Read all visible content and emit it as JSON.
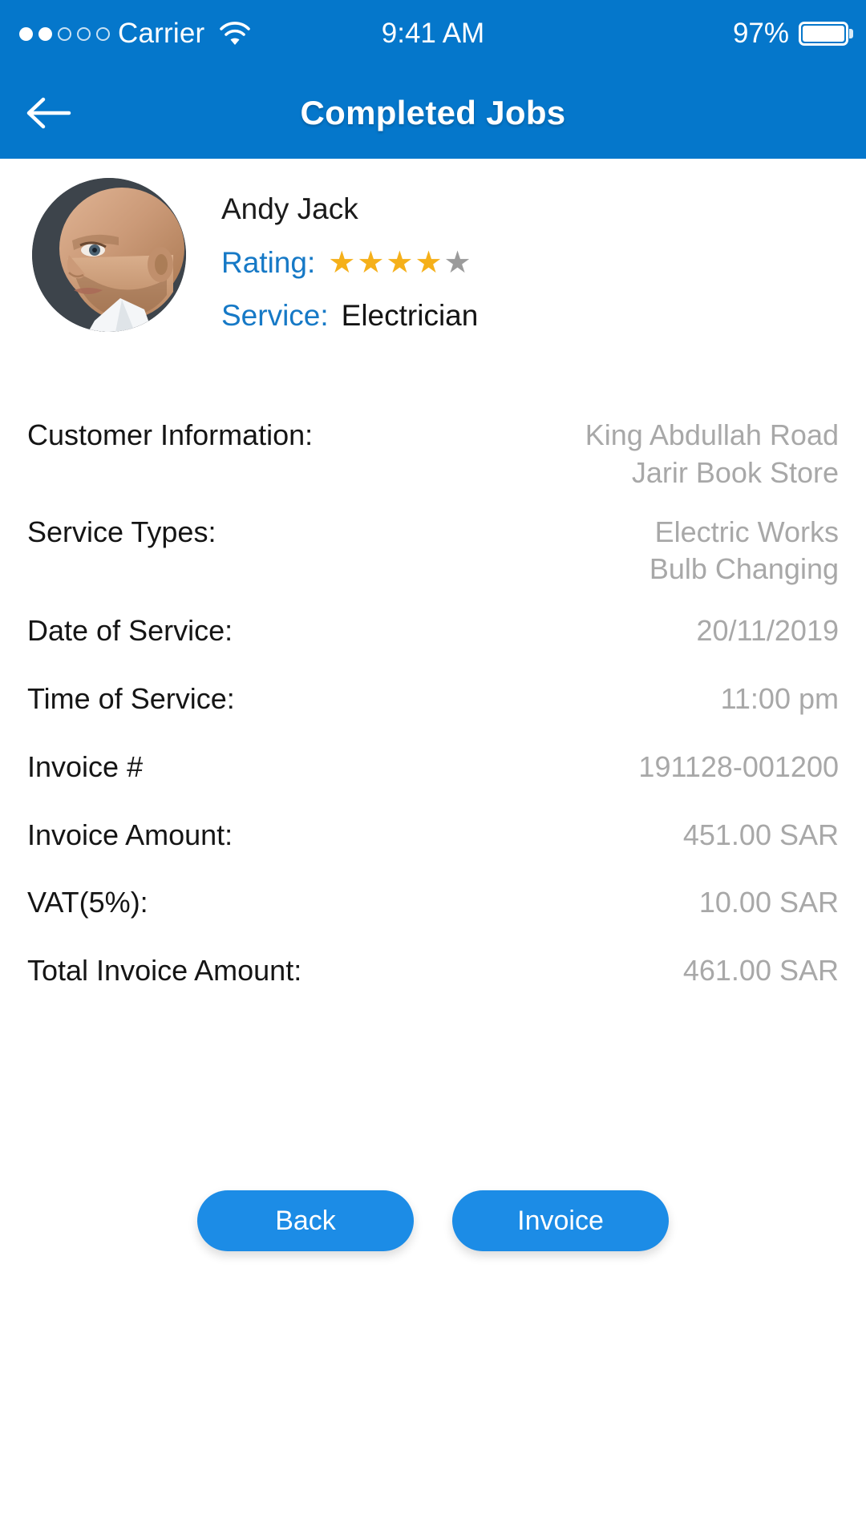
{
  "status_bar": {
    "carrier": "Carrier",
    "signal_dots_filled": 2,
    "signal_dots_total": 5,
    "wifi_icon": "wifi-icon",
    "time": "9:41 AM",
    "battery_percent": "97%"
  },
  "navbar": {
    "back_icon": "back-arrow-icon",
    "title": "Completed Jobs"
  },
  "profile": {
    "avatar_alt": "avatar",
    "name": "Andy Jack",
    "rating_label": "Rating:",
    "rating_value": 4,
    "rating_max": 5,
    "service_label": "Service:",
    "service_value": "Electrician"
  },
  "details": [
    {
      "label": "Customer Information:",
      "value": "King Abdullah Road\nJarir Book Store"
    },
    {
      "label": "Service Types:",
      "value": "Electric Works\nBulb Changing"
    },
    {
      "label": "Date of Service:",
      "value": "20/11/2019"
    },
    {
      "label": "Time of Service:",
      "value": "11:00 pm"
    },
    {
      "label": "Invoice #",
      "value": "191128-001200"
    },
    {
      "label": "Invoice Amount:",
      "value": "451.00 SAR"
    },
    {
      "label": "VAT(5%):",
      "value": "10.00 SAR"
    },
    {
      "label": "Total Invoice Amount:",
      "value": "461.00 SAR"
    }
  ],
  "actions": {
    "back_label": "Back",
    "invoice_label": "Invoice"
  },
  "colors": {
    "header_blue": "#0577cb",
    "button_blue": "#1c8ce6",
    "link_blue": "#1679c6",
    "value_gray": "#a8a8a8",
    "star_on": "#f5b01a",
    "star_off": "#9b9b9b"
  }
}
